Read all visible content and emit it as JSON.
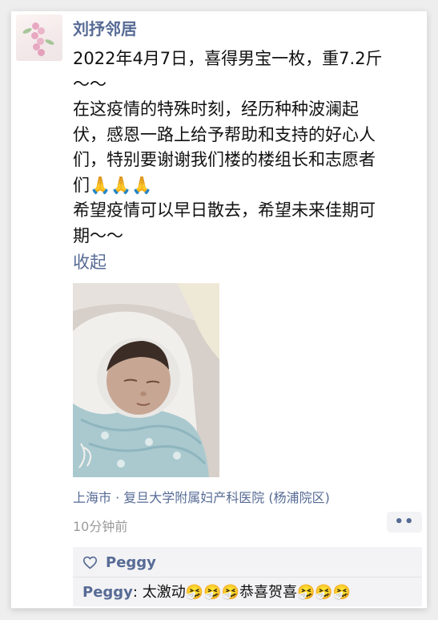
{
  "post": {
    "author": "刘抒邻居",
    "lines": [
      "2022年4月7日，喜得男宝一枚，重7.2斤",
      "～～",
      "在这疫情的特殊时刻，经历种种波澜起",
      "伏，感恩一路上给予帮助和支持的好心人",
      "们，特别要谢谢我们楼的楼组长和志愿者",
      "们🙏🙏🙏",
      "希望疫情可以早日散去，希望未来佳期可",
      "期～～"
    ],
    "collapse_label": "收起",
    "location": "上海市 · 复旦大学附属妇产科医院 (杨浦院区)",
    "time": "10分钟前",
    "more_label": "••"
  },
  "interactions": {
    "like_icon": "heart-outline-icon",
    "likes": [
      "Peggy"
    ],
    "comments": [
      {
        "name": "Peggy",
        "separator": ": ",
        "text": "太激动🤧🤧🤧恭喜贺喜🤧🤧🤧"
      }
    ]
  },
  "colors": {
    "link": "#576b95",
    "text": "#111111",
    "meta": "#9a9a9a",
    "panel": "#f3f3f5"
  }
}
